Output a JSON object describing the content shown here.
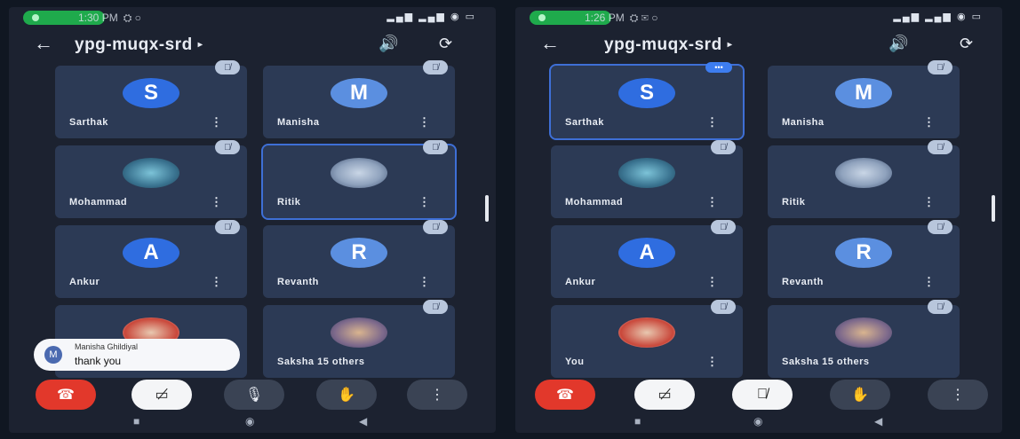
{
  "left": {
    "status": {
      "time": "1:30 PM",
      "extra": "⛭ ○",
      "sys": "▂▄▆ ▂▄▆ ◉ ▭"
    },
    "meeting": {
      "code": "ypg-muqx-srd",
      "caret": "▸",
      "back": "←",
      "speaker_icon": "🔊",
      "camera_icon": "⟳"
    },
    "tiles": [
      {
        "name": "Sarthak",
        "initial": "S"
      },
      {
        "name": "Manisha",
        "initial": "M"
      },
      {
        "name": "Mohammad",
        "initial": ""
      },
      {
        "name": "Ritik",
        "initial": ""
      },
      {
        "name": "Ankur",
        "initial": "A"
      },
      {
        "name": "Revanth",
        "initial": "R"
      },
      {
        "name": "",
        "initial": ""
      },
      {
        "name": "Saksha  15 others",
        "initial": ""
      }
    ],
    "toast": {
      "initial": "M",
      "sender": "Manisha Ghildiyal",
      "message": "thank you"
    }
  },
  "right": {
    "status": {
      "time": "1:26 PM",
      "extra": "⛭ ✉ ○",
      "sys": "▂▄▆ ▂▄▆ ◉ ▭"
    },
    "meeting": {
      "code": "ypg-muqx-srd",
      "caret": "▸",
      "back": "←",
      "speaker_icon": "🔊",
      "camera_icon": "⟳"
    },
    "tiles": [
      {
        "name": "Sarthak",
        "initial": "S"
      },
      {
        "name": "Manisha",
        "initial": "M"
      },
      {
        "name": "Mohammad",
        "initial": ""
      },
      {
        "name": "Ritik",
        "initial": ""
      },
      {
        "name": "Ankur",
        "initial": "A"
      },
      {
        "name": "Revanth",
        "initial": "R"
      },
      {
        "name": "You",
        "initial": ""
      },
      {
        "name": "Saksha  15 others",
        "initial": ""
      }
    ]
  },
  "icons": {
    "more": "⋮",
    "mic_off": "🎙̸",
    "speaking": "•••",
    "end_call": "☎",
    "video_off": "▭̸",
    "mic": "🎙",
    "hand": "✋",
    "menu": "⋮",
    "nav_recent": "■",
    "nav_home": "◉",
    "nav_back": "◀"
  }
}
